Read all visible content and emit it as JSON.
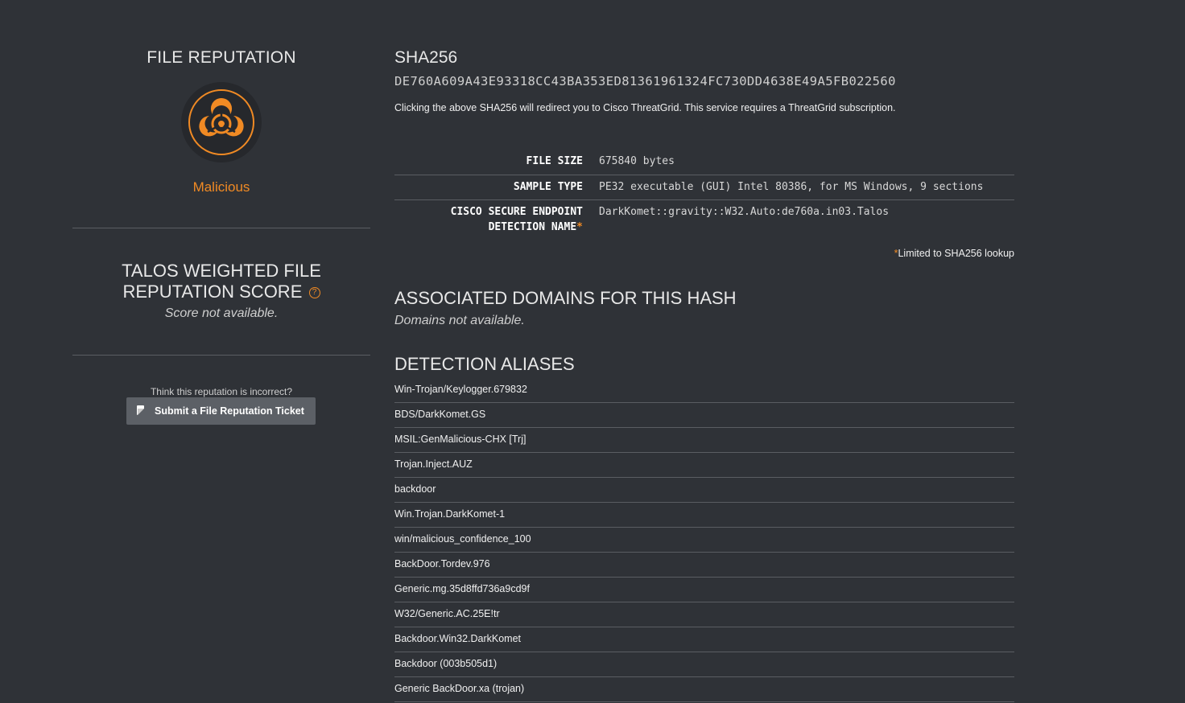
{
  "left": {
    "heading": "FILE REPUTATION",
    "icon": "biohazard-icon",
    "verdict": "Malicious",
    "verdict_color": "#f08a24",
    "score_title": "TALOS WEIGHTED FILE REPUTATION SCORE",
    "help_icon_glyph": "?",
    "score_value": "Score not available.",
    "incorrect_prompt": "Think this reputation is incorrect?",
    "ticket_button": "Submit a File Reputation Ticket"
  },
  "sha": {
    "title": "SHA256",
    "value": "DE760A609A43E93318CC43BA353ED81361961324FC730DD4638E49A5FB022560",
    "note": "Clicking the above SHA256 will redirect you to Cisco ThreatGrid. This service requires a ThreatGrid subscription."
  },
  "details": {
    "file_size_label": "FILE SIZE",
    "file_size_value": "675840 bytes",
    "sample_type_label": "SAMPLE TYPE",
    "sample_type_value": "PE32 executable (GUI) Intel 80386, for MS Windows, 9 sections",
    "endpoint_label_1": "CISCO SECURE ENDPOINT",
    "endpoint_label_2": "DETECTION NAME",
    "endpoint_star": "*",
    "endpoint_value": "DarkKomet::gravity::W32.Auto:de760a.in03.Talos",
    "limited_star": "*",
    "limited_note": "Limited to SHA256 lookup"
  },
  "domains": {
    "title": "ASSOCIATED DOMAINS FOR THIS HASH",
    "value": "Domains not available."
  },
  "aliases": {
    "title": "DETECTION ALIASES",
    "items": [
      "Win-Trojan/Keylogger.679832",
      "BDS/DarkKomet.GS",
      "MSIL:GenMalicious-CHX [Trj]",
      "Trojan.Inject.AUZ",
      "backdoor",
      "Win.Trojan.DarkKomet-1",
      "win/malicious_confidence_100",
      "BackDoor.Tordev.976",
      "Generic.mg.35d8ffd736a9cd9f",
      "W32/Generic.AC.25E!tr",
      "Backdoor.Win32.DarkKomet",
      "Backdoor (003b505d1)",
      "Generic BackDoor.xa (trojan)"
    ]
  }
}
